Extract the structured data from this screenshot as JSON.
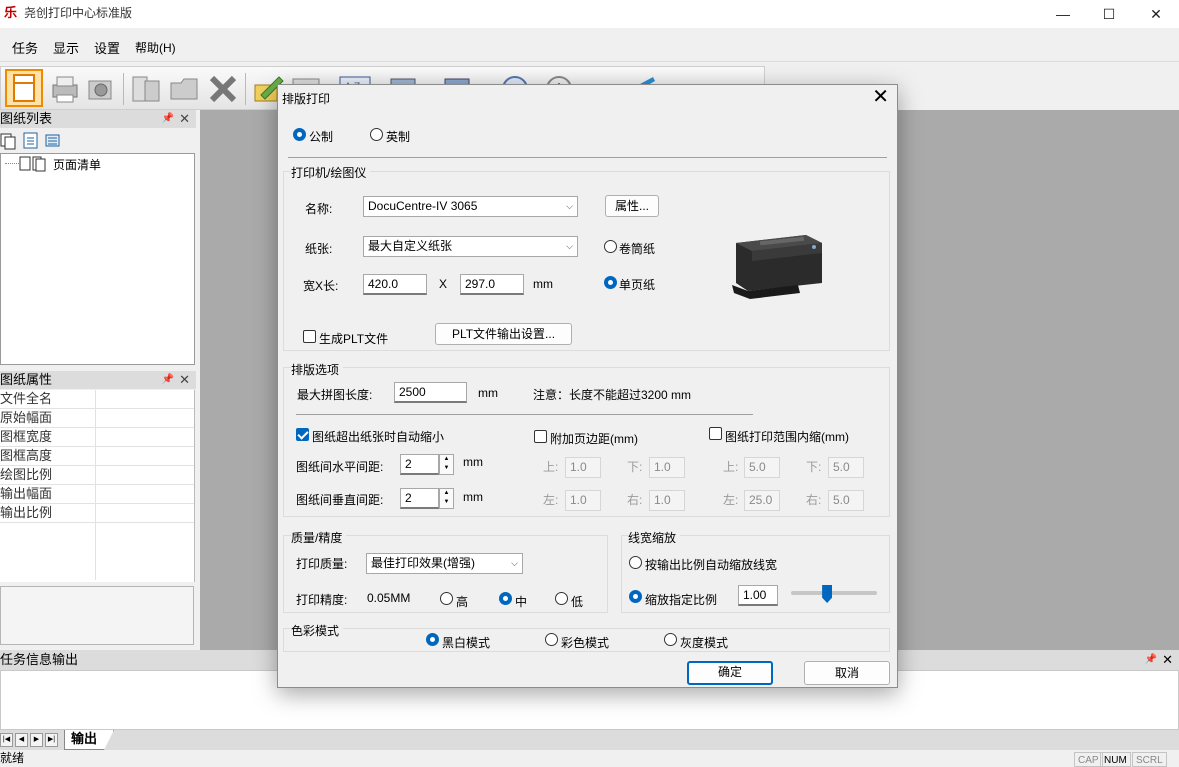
{
  "app": {
    "title": "尧创打印中心标准版",
    "logo_glyph": "乐",
    "minimize": "—",
    "maximize": "☐",
    "close": "✕"
  },
  "menu": [
    "任务",
    "显示",
    "设置",
    "帮助(H)"
  ],
  "left": {
    "drawing_list": {
      "title": "图纸列表",
      "tree_item": "页面清单"
    },
    "drawing_props": {
      "title": "图纸属性",
      "rows": [
        "文件全名",
        "原始幅面",
        "图框宽度",
        "图框高度",
        "绘图比例",
        "输出幅面",
        "输出比例"
      ]
    },
    "pin": "ᵖ",
    "close": "✕"
  },
  "output": {
    "title": "任务信息输出",
    "tab": "输出"
  },
  "status": {
    "ready": "就绪",
    "cap": "CAP",
    "num": "NUM",
    "scrl": "SCRL"
  },
  "dialog": {
    "title": "排版打印",
    "close": "✕",
    "units": {
      "metric": "公制",
      "imperial": "英制"
    },
    "printer": {
      "group": "打印机/绘图仪",
      "name_label": "名称:",
      "name_value": "DocuCentre-IV 3065",
      "properties_btn": "属性...",
      "paper_label": "纸张:",
      "paper_value": "最大自定义纸张",
      "roll_paper": "卷筒纸",
      "single_paper": "单页纸",
      "size_label": "宽X长:",
      "width": "420.0",
      "x": "X",
      "height": "297.0",
      "mm": "mm",
      "plt_check": "生成PLT文件",
      "plt_btn": "PLT文件输出设置..."
    },
    "layout": {
      "group": "排版选项",
      "max_len_label": "最大拼图长度:",
      "max_len_value": "2500",
      "mm": "mm",
      "note": "注意：长度不能超过3200 mm",
      "auto_shrink": "图纸超出纸张时自动缩小",
      "add_margin": "附加页边距(mm)",
      "inner_shrink": "图纸打印范围内缩(mm)",
      "h_gap_label": "图纸间水平间距:",
      "h_gap": "2",
      "v_gap_label": "图纸间垂直间距:",
      "v_gap": "2",
      "up": "上:",
      "down": "下:",
      "left": "左:",
      "right": "右:",
      "margin": {
        "top": "1.0",
        "bottom": "1.0",
        "left": "1.0",
        "right": "1.0"
      },
      "inset": {
        "top": "5.0",
        "bottom": "5.0",
        "left": "25.0",
        "right": "5.0"
      }
    },
    "quality": {
      "group": "质量/精度",
      "quality_label": "打印质量:",
      "quality_value": "最佳打印效果(增强)",
      "precision_label": "打印精度:",
      "precision_value": "0.05MM",
      "high": "高",
      "mid": "中",
      "low": "低"
    },
    "linewidth": {
      "group": "线宽缩放",
      "auto": "按输出比例自动缩放线宽",
      "specified": "缩放指定比例",
      "scale": "1.00",
      "slider_level": 0.42
    },
    "color": {
      "group": "色彩模式",
      "bw": "黑白模式",
      "color": "彩色模式",
      "gray": "灰度模式"
    },
    "ok": "确定",
    "cancel": "取消"
  },
  "colors": {
    "accent": "#0067c0",
    "workarea": "#abaaaa"
  }
}
